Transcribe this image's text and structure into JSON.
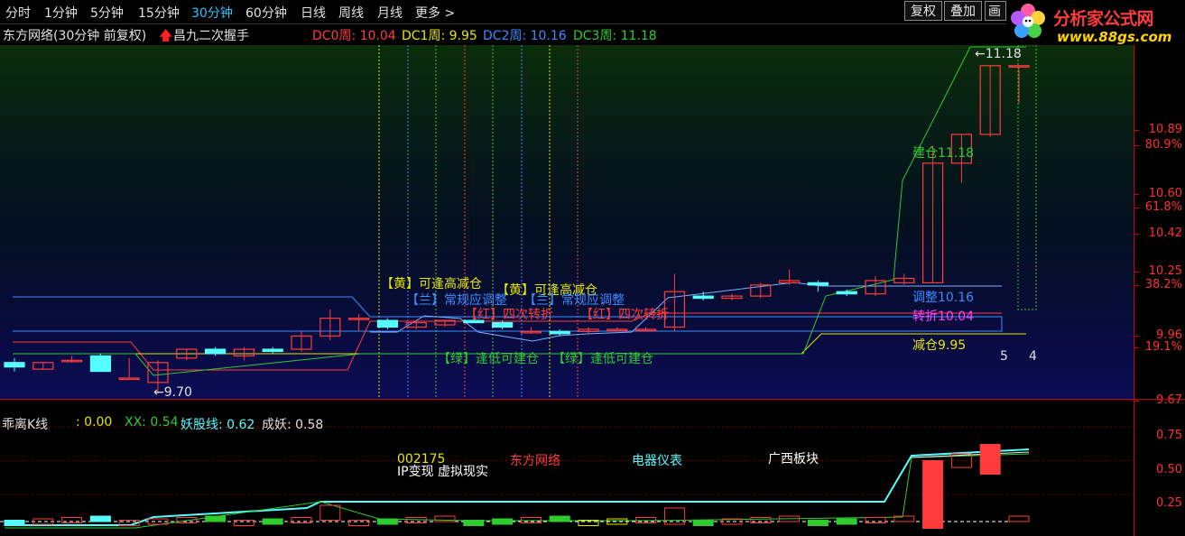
{
  "timeframes": {
    "items": [
      "分时",
      "1分钟",
      "5分钟",
      "15分钟",
      "30分钟",
      "60分钟",
      "日线",
      "周线",
      "月线",
      "更多"
    ],
    "active": "30分钟",
    "more_arrow": ">"
  },
  "toolbar": {
    "fuquan": "复权",
    "diejia": "叠加",
    "hua": "画"
  },
  "logo": {
    "title": "分析家公式网",
    "url": "www.88gs.com"
  },
  "info": {
    "stock": "东方网络(30分钟 前复权)",
    "indicator": "昌九二次握手",
    "dc0": "DC0周: 10.04",
    "dc1": "DC1周: 9.95",
    "dc2": "DC2周: 10.16",
    "dc3": "DC3周: 11.18"
  },
  "price_axis": {
    "ticks": [
      {
        "label": "10.89",
        "price": 10.89
      },
      {
        "label": "80.9%",
        "price": 10.82
      },
      {
        "label": "10.60",
        "price": 10.6
      },
      {
        "label": "61.8%",
        "price": 10.54
      },
      {
        "label": "10.42",
        "price": 10.42
      },
      {
        "label": "10.25",
        "price": 10.25
      },
      {
        "label": "38.2%",
        "price": 10.19
      },
      {
        "label": "9.96",
        "price": 9.96
      },
      {
        "label": "19.1%",
        "price": 9.91
      },
      {
        "label": "9.67",
        "price": 9.67
      }
    ],
    "lower_ticks": [
      {
        "label": "0.75",
        "value": 0.75
      },
      {
        "label": "0.50",
        "value": 0.5
      },
      {
        "label": "0.25",
        "value": 0.25
      }
    ]
  },
  "annotations": {
    "high_marker": "←11.18",
    "low_marker": "←9.70",
    "huang1": "【黄】可逢高减仓",
    "huang2": "【黄】可逢高减仓",
    "lan1": "【兰】常规应调整",
    "lan2": "【兰】常规应调整",
    "hong1": "【红】四次转折",
    "hong2": "【红】四次转折",
    "lv1": "【绿】逢低可建仓",
    "lv2": "【绿】逢低可建仓",
    "jiancang": "建仓11.18",
    "tiaozheng": "调整10.16",
    "zhuanzhe": "转折10.04",
    "jiancang2": "减仓9.95",
    "count_a": "5",
    "count_b": "4"
  },
  "lower": {
    "title": "乖离K线",
    "value": ": 0.00",
    "xx": "XX: 0.54",
    "yaogu": "妖股线: 0.62",
    "chengyao": "成妖: 0.58",
    "code": "002175",
    "name": "东方网络",
    "concept": "IP变现 虚拟现实",
    "industry": "电器仪表",
    "region": "广西板块"
  },
  "colors": {
    "up": "#ff3c3c",
    "down": "#54ffff",
    "yellow": "#e6e600",
    "blue": "#3c8cff",
    "green": "#2ecc2e",
    "magenta": "#ff40ff"
  },
  "chart_data": {
    "type": "candlestick",
    "note_units": "price (CNY)",
    "dc_levels": {
      "DC0": 10.04,
      "DC1": 9.95,
      "DC2": 10.16,
      "DC3": 11.18
    },
    "candles": [
      {
        "o": 9.84,
        "h": 9.86,
        "l": 9.8,
        "c": 9.82
      },
      {
        "o": 9.81,
        "h": 9.84,
        "l": 9.81,
        "c": 9.84
      },
      {
        "o": 9.85,
        "h": 9.87,
        "l": 9.84,
        "c": 9.85
      },
      {
        "o": 9.87,
        "h": 9.88,
        "l": 9.8,
        "c": 9.8
      },
      {
        "o": 9.77,
        "h": 9.86,
        "l": 9.77,
        "c": 9.77
      },
      {
        "o": 9.75,
        "h": 9.85,
        "l": 9.7,
        "c": 9.84
      },
      {
        "o": 9.86,
        "h": 9.9,
        "l": 9.85,
        "c": 9.9
      },
      {
        "o": 9.9,
        "h": 9.91,
        "l": 9.87,
        "c": 9.88
      },
      {
        "o": 9.87,
        "h": 9.91,
        "l": 9.85,
        "c": 9.9
      },
      {
        "o": 9.9,
        "h": 9.91,
        "l": 9.88,
        "c": 9.89
      },
      {
        "o": 9.9,
        "h": 9.98,
        "l": 9.89,
        "c": 9.96
      },
      {
        "o": 9.96,
        "h": 10.08,
        "l": 9.94,
        "c": 10.04
      },
      {
        "o": 10.04,
        "h": 10.06,
        "l": 9.98,
        "c": 10.04
      },
      {
        "o": 10.03,
        "h": 10.04,
        "l": 9.99,
        "c": 10.0
      },
      {
        "o": 10.0,
        "h": 10.03,
        "l": 9.99,
        "c": 10.02
      },
      {
        "o": 10.01,
        "h": 10.03,
        "l": 10.0,
        "c": 10.03
      },
      {
        "o": 10.03,
        "h": 10.04,
        "l": 10.02,
        "c": 10.02
      },
      {
        "o": 10.02,
        "h": 10.03,
        "l": 9.99,
        "c": 10.0
      },
      {
        "o": 9.98,
        "h": 10.0,
        "l": 9.97,
        "c": 9.98
      },
      {
        "o": 9.98,
        "h": 9.99,
        "l": 9.96,
        "c": 9.97
      },
      {
        "o": 9.98,
        "h": 10.0,
        "l": 9.97,
        "c": 9.99
      },
      {
        "o": 9.99,
        "h": 10.0,
        "l": 9.99,
        "c": 9.99
      },
      {
        "o": 9.99,
        "h": 10.0,
        "l": 9.98,
        "c": 9.99
      },
      {
        "o": 10.0,
        "h": 10.24,
        "l": 9.98,
        "c": 10.16
      },
      {
        "o": 10.14,
        "h": 10.16,
        "l": 10.12,
        "c": 10.13
      },
      {
        "o": 10.13,
        "h": 10.15,
        "l": 10.12,
        "c": 10.14
      },
      {
        "o": 10.14,
        "h": 10.2,
        "l": 10.13,
        "c": 10.19
      },
      {
        "o": 10.2,
        "h": 10.26,
        "l": 10.19,
        "c": 10.21
      },
      {
        "o": 10.2,
        "h": 10.21,
        "l": 10.16,
        "c": 10.19
      },
      {
        "o": 10.16,
        "h": 10.17,
        "l": 10.14,
        "c": 10.15
      },
      {
        "o": 10.15,
        "h": 10.23,
        "l": 10.14,
        "c": 10.21
      },
      {
        "o": 10.2,
        "h": 10.24,
        "l": 10.19,
        "c": 10.22
      },
      {
        "o": 10.2,
        "h": 10.82,
        "l": 10.2,
        "c": 10.74
      },
      {
        "o": 10.74,
        "h": 10.87,
        "l": 10.65,
        "c": 10.87
      },
      {
        "o": 10.87,
        "h": 11.18,
        "l": 10.86,
        "c": 11.18
      },
      {
        "o": 11.18,
        "h": 11.18,
        "l": 11.01,
        "c": 11.18
      }
    ],
    "lower_series": {
      "XX": 0.54,
      "妖股线": 0.62,
      "成妖": 0.58
    }
  }
}
